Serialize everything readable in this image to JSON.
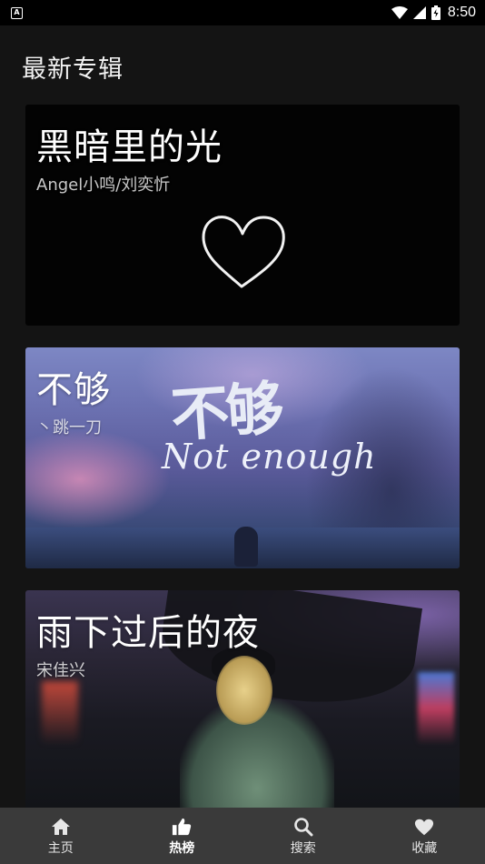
{
  "status_bar": {
    "time": "8:50",
    "app_icon": "A"
  },
  "page": {
    "title": "最新专辑"
  },
  "albums": [
    {
      "title": "黑暗里的光",
      "artist": "Angel小鸣/刘奕忻"
    },
    {
      "title": "不够",
      "artist": "丶跳一刀",
      "cover_text": "不够",
      "cover_script": "Not enough"
    },
    {
      "title": "雨下过后的夜",
      "artist": "宋佳兴"
    }
  ],
  "bottom_nav": {
    "items": [
      {
        "label": "主页",
        "icon": "home-icon"
      },
      {
        "label": "热榜",
        "icon": "thumbs-up-icon"
      },
      {
        "label": "搜索",
        "icon": "search-icon"
      },
      {
        "label": "收藏",
        "icon": "heart-icon"
      }
    ],
    "active_index": 1
  },
  "colors": {
    "background": "#141414",
    "status_bar": "#000000",
    "nav_background": "#3a3a3a"
  }
}
